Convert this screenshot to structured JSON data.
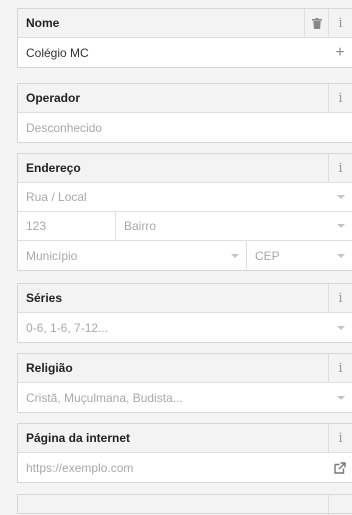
{
  "fields": {
    "nome": {
      "label": "Nome",
      "value": "Colégio MC",
      "info": "i",
      "add": "+"
    },
    "operador": {
      "label": "Operador",
      "placeholder": "Desconhecido",
      "info": "i"
    },
    "endereco": {
      "label": "Endereço",
      "info": "i",
      "street_placeholder": "Rua / Local",
      "number_placeholder": "123",
      "district_placeholder": "Bairro",
      "city_placeholder": "Município",
      "postcode_placeholder": "CEP"
    },
    "series": {
      "label": "Séries",
      "placeholder": "0-6, 1-6, 7-12...",
      "info": "i"
    },
    "religiao": {
      "label": "Religião",
      "placeholder": "Cristã, Muçulmana, Budista...",
      "info": "i"
    },
    "website": {
      "label": "Página da internet",
      "placeholder": "https://exemplo.com",
      "info": "i"
    }
  },
  "icons": {
    "delete": "trash-icon",
    "add": "plus-icon",
    "info": "info-icon",
    "open_link": "external-link-icon"
  }
}
